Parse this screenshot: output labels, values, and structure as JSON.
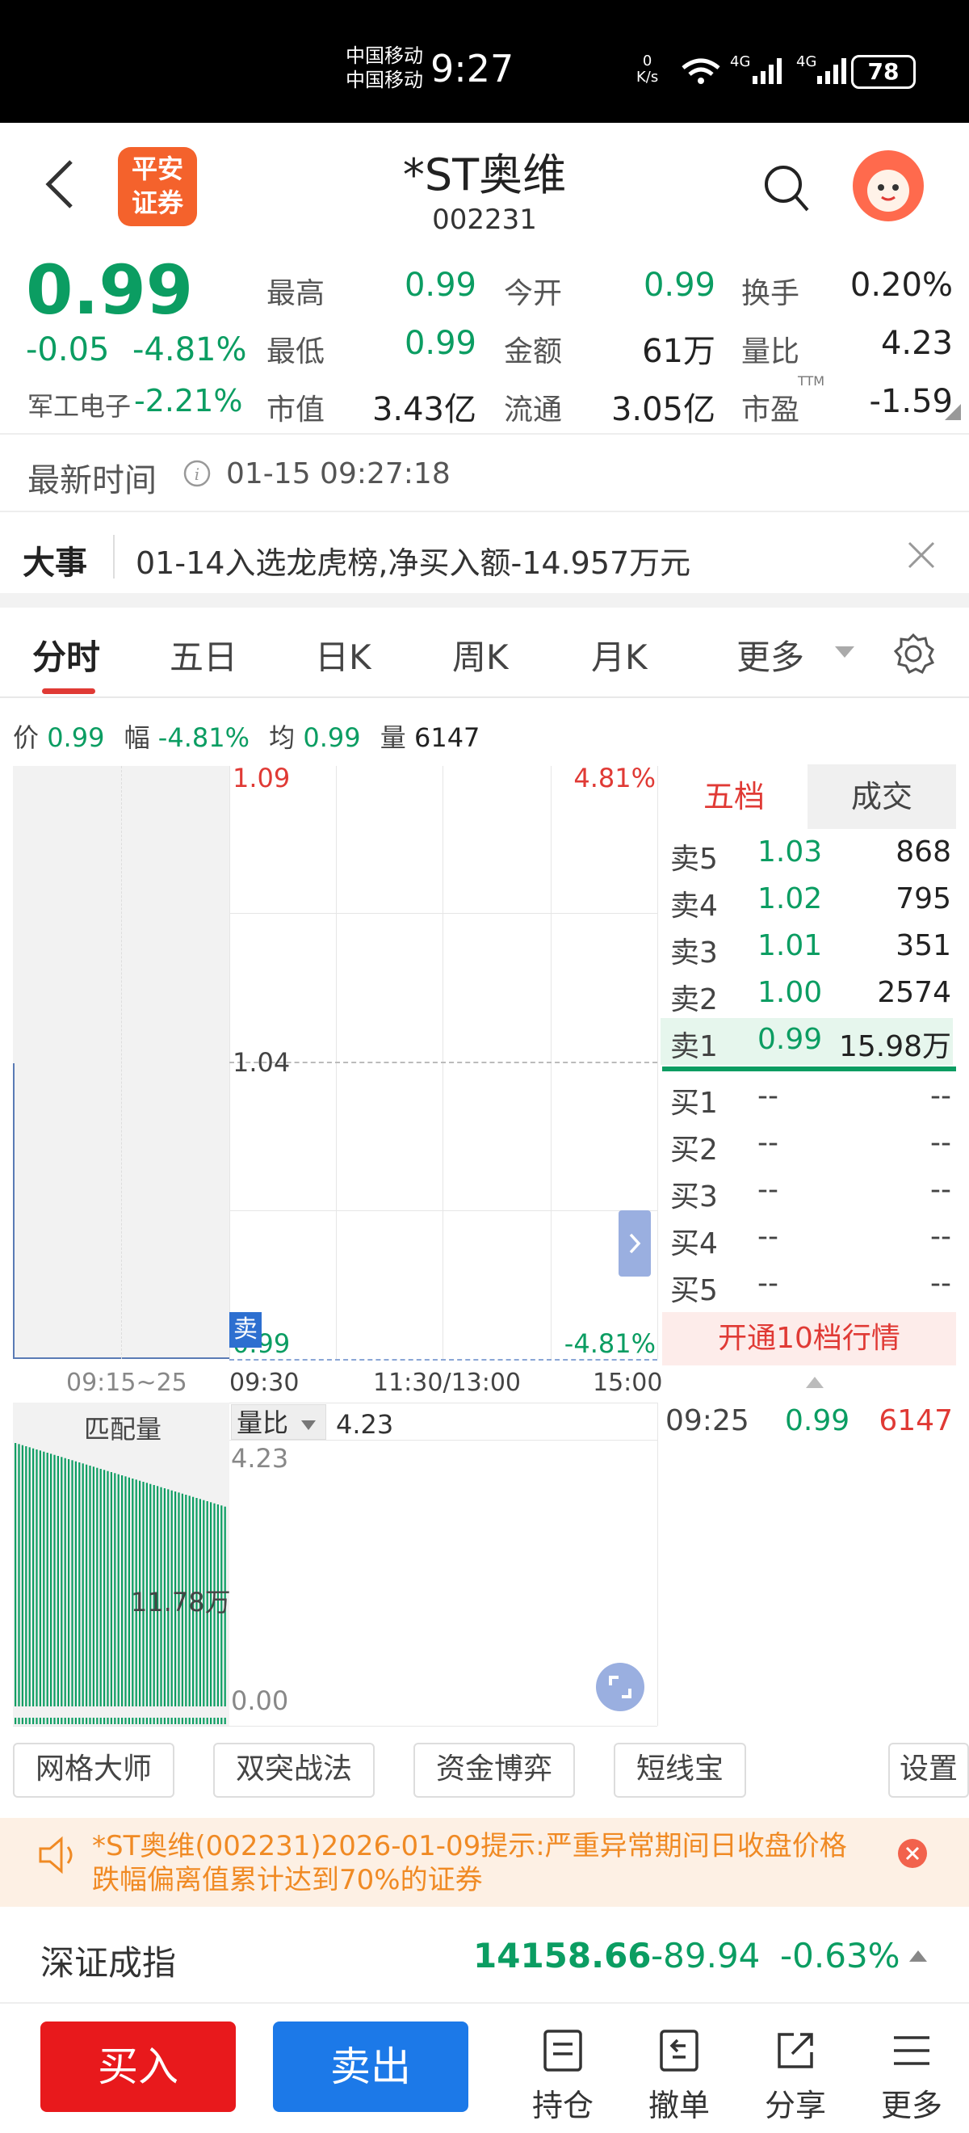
{
  "status_bar": {
    "carrier1": "中国移动",
    "carrier2": "中国移动",
    "time": "9:27",
    "net_speed_value": "0",
    "net_speed_unit": "K/s",
    "net1": "4G",
    "net2": "4G",
    "battery": "78"
  },
  "header": {
    "logo_line1": "平安",
    "logo_line2": "证券",
    "stock_name": "*ST奥维",
    "stock_code": "002231"
  },
  "quote": {
    "price": "0.99",
    "change": "-0.05",
    "change_pct": "-4.81%",
    "sector_name": "军工电子",
    "sector_pct": "-2.21%",
    "fields": [
      {
        "label": "最高",
        "value": "0.99"
      },
      {
        "label": "今开",
        "value": "0.99"
      },
      {
        "label": "换手",
        "value": "0.20%"
      },
      {
        "label": "最低",
        "value": "0.99"
      },
      {
        "label": "金额",
        "value": "61万"
      },
      {
        "label": "量比",
        "value": "4.23"
      },
      {
        "label": "市值",
        "value": "3.43亿"
      },
      {
        "label": "流通",
        "value": "3.05亿"
      },
      {
        "label": "市盈",
        "value": "-1.59",
        "sup": "TTM"
      }
    ]
  },
  "latest_time": {
    "label": "最新时间",
    "value": "01-15 09:27:18"
  },
  "event": {
    "label": "大事",
    "text": "01-14入选龙虎榜,净买入额-14.957万元"
  },
  "tabs": [
    "分时",
    "五日",
    "日K",
    "周K",
    "月K",
    "更多"
  ],
  "info_line": {
    "price_label": "价",
    "price": "0.99",
    "amp_label": "幅",
    "amp": "-4.81%",
    "avg_label": "均",
    "avg": "0.99",
    "vol_label": "量",
    "vol": "6147"
  },
  "chart_data": {
    "type": "line",
    "title": "",
    "y_top": "1.09",
    "y_mid": "1.04",
    "y_bottom": "0.99",
    "pct_top": "4.81%",
    "pct_bottom": "-4.81%",
    "ylim": [
      0.99,
      1.09
    ],
    "x_ticks": [
      "09:15~25",
      "09:30",
      "11:30/13:00",
      "15:00"
    ],
    "series": [
      {
        "x": [
          "09:25"
        ],
        "values": [
          0.99
        ]
      }
    ],
    "sell_tag": "卖",
    "volume": {
      "auction_label": "匹配量",
      "indicator_label": "量比",
      "indicator_value": "4.23",
      "top": "4.23",
      "bottom": "0.00",
      "auction_peak": "11.78万"
    }
  },
  "order_book": {
    "tab_active": "五档",
    "tab_other": "成交",
    "asks": [
      {
        "label": "卖5",
        "price": "1.03",
        "vol": "868"
      },
      {
        "label": "卖4",
        "price": "1.02",
        "vol": "795"
      },
      {
        "label": "卖3",
        "price": "1.01",
        "vol": "351"
      },
      {
        "label": "卖2",
        "price": "1.00",
        "vol": "2574"
      },
      {
        "label": "卖1",
        "price": "0.99",
        "vol": "15.98万"
      }
    ],
    "bids": [
      {
        "label": "买1",
        "price": "--",
        "vol": "--"
      },
      {
        "label": "买2",
        "price": "--",
        "vol": "--"
      },
      {
        "label": "买3",
        "price": "--",
        "vol": "--"
      },
      {
        "label": "买4",
        "price": "--",
        "vol": "--"
      },
      {
        "label": "买5",
        "price": "--",
        "vol": "--"
      }
    ],
    "promo": "开通10档行情",
    "trade": {
      "time": "09:25",
      "price": "0.99",
      "vol": "6147"
    }
  },
  "tools": [
    "网格大师",
    "双突战法",
    "资金博弈",
    "短线宝",
    "设置"
  ],
  "notice": "*ST奥维(002231)2026-01-09提示:严重异常期间日收盘价格跌幅偏离值累计达到70%的证券",
  "index": {
    "name": "深证成指",
    "value": "14158.66",
    "change": "-89.94",
    "pct": "-0.63%"
  },
  "bottom": {
    "buy": "买入",
    "sell": "卖出",
    "items": [
      "持仓",
      "撤单",
      "分享",
      "更多"
    ]
  },
  "colors": {
    "up": "#e03a35",
    "down": "#0b9d62",
    "buy_btn": "#e8191c",
    "sell_btn": "#1c79e8"
  }
}
